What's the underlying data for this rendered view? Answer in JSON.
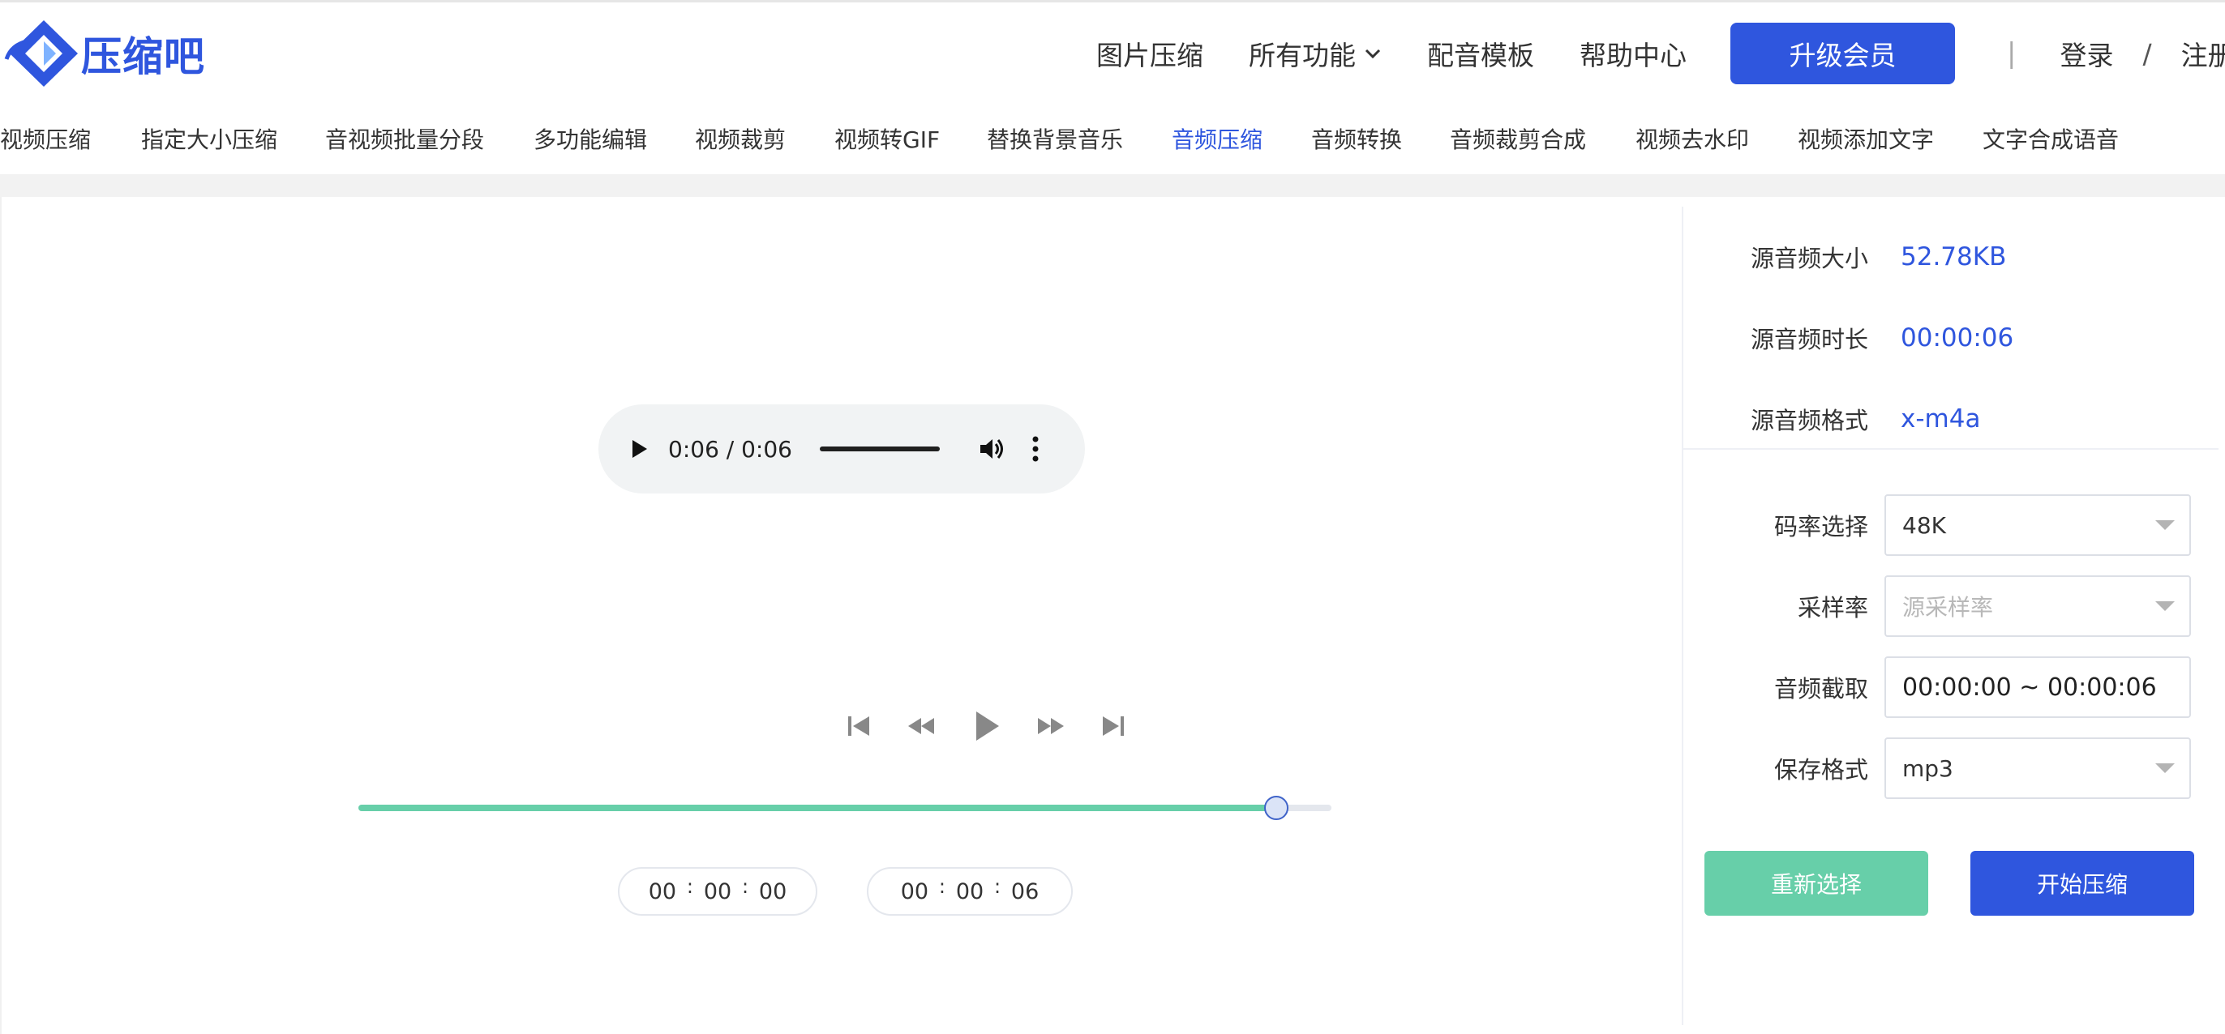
{
  "brand": {
    "name": "压缩吧"
  },
  "top_nav": {
    "items": [
      "图片压缩",
      "所有功能",
      "配音模板",
      "帮助中心"
    ],
    "upgrade": "升级会员",
    "separator": "|",
    "login": "登录",
    "slash": "/",
    "register": "注册"
  },
  "sub_nav": {
    "items": [
      "视频压缩",
      "指定大小压缩",
      "音视频批量分段",
      "多功能编辑",
      "视频裁剪",
      "视频转GIF",
      "替换背景音乐",
      "音频压缩",
      "音频转换",
      "音频裁剪合成",
      "视频去水印",
      "视频添加文字",
      "文字合成语音"
    ],
    "active_index": 7
  },
  "audio_player": {
    "time": "0:06 / 0:06"
  },
  "trim": {
    "progress_fraction": 1.0,
    "start": [
      "00",
      "00",
      "00"
    ],
    "end": [
      "00",
      "00",
      "06"
    ],
    "colon": ":"
  },
  "info": {
    "size_label": "源音频大小",
    "size_value": "52.78KB",
    "duration_label": "源音频时长",
    "duration_value": "00:00:06",
    "format_label": "源音频格式",
    "format_value": "x-m4a"
  },
  "form": {
    "bitrate_label": "码率选择",
    "bitrate_value": "48K",
    "samplerate_label": "采样率",
    "samplerate_placeholder": "源采样率",
    "clip_label": "音频截取",
    "clip_value": "00:00:00 ~ 00:00:06",
    "save_format_label": "保存格式",
    "save_format_value": "mp3"
  },
  "buttons": {
    "reselect": "重新选择",
    "start": "开始压缩"
  },
  "colors": {
    "brand_blue": "#2f56de",
    "accent_green": "#67cfa9"
  }
}
